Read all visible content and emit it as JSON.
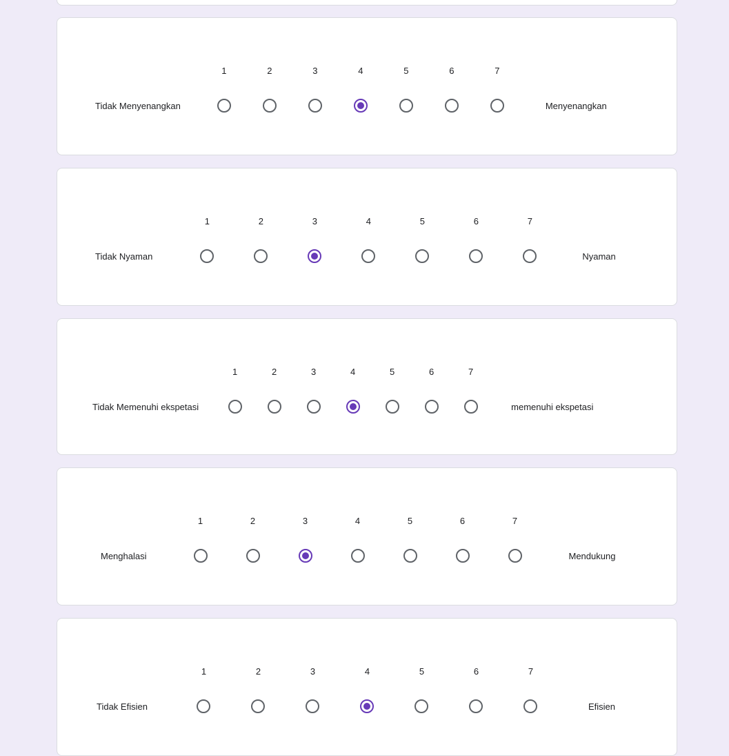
{
  "questions": [
    {
      "low_label": "Tidak Menyenangkan",
      "high_label": "Menyenangkan",
      "scale": [
        "1",
        "2",
        "3",
        "4",
        "5",
        "6",
        "7"
      ],
      "selected": 4
    },
    {
      "low_label": "Tidak Nyaman",
      "high_label": "Nyaman",
      "scale": [
        "1",
        "2",
        "3",
        "4",
        "5",
        "6",
        "7"
      ],
      "selected": 3
    },
    {
      "low_label": "Tidak Memenuhi ekspetasi",
      "high_label": "memenuhi ekspetasi",
      "scale": [
        "1",
        "2",
        "3",
        "4",
        "5",
        "6",
        "7"
      ],
      "selected": 4
    },
    {
      "low_label": "Menghalasi",
      "high_label": "Mendukung",
      "scale": [
        "1",
        "2",
        "3",
        "4",
        "5",
        "6",
        "7"
      ],
      "selected": 3
    },
    {
      "low_label": "Tidak Efisien",
      "high_label": "Efisien",
      "scale": [
        "1",
        "2",
        "3",
        "4",
        "5",
        "6",
        "7"
      ],
      "selected": 4
    }
  ],
  "colors": {
    "page_background": "#efebf8",
    "card_background": "#ffffff",
    "accent": "#673ab7",
    "radio_border": "#5f6368"
  }
}
